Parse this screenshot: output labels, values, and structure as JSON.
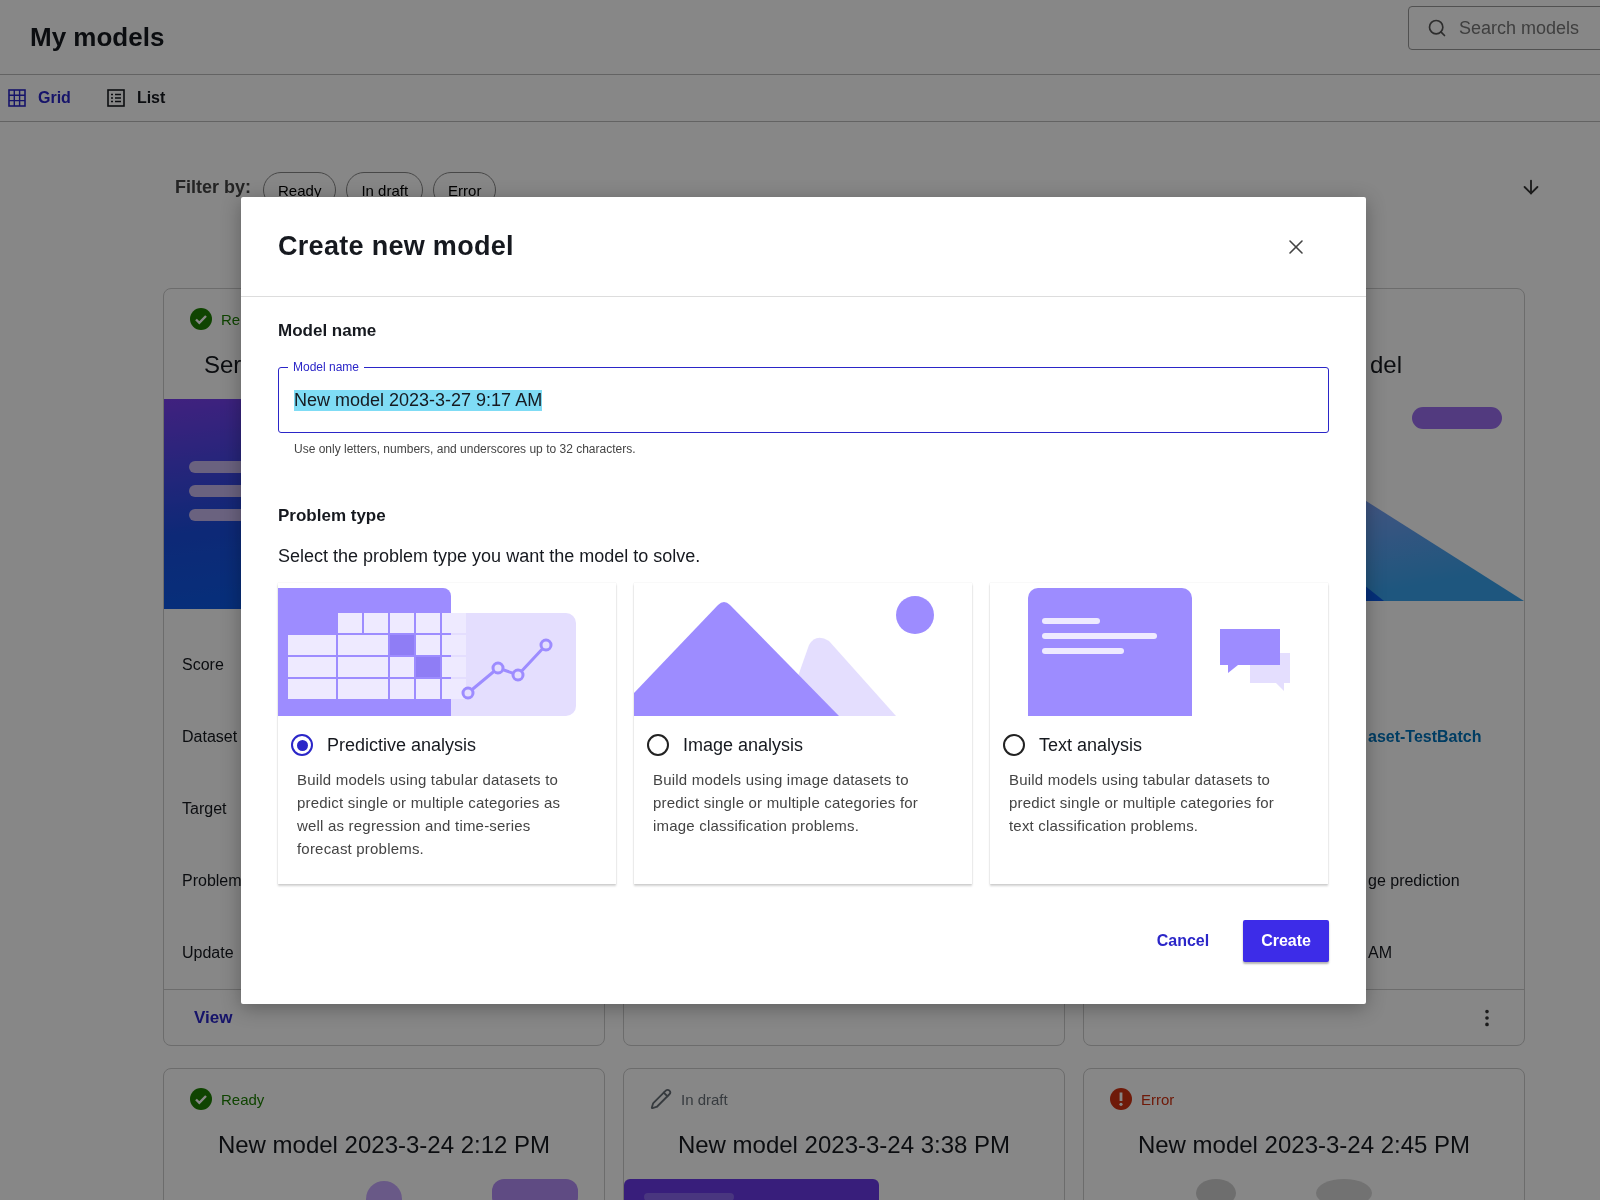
{
  "header": {
    "title": "My models",
    "search": {
      "placeholder": "Search models"
    }
  },
  "view_tabs": [
    {
      "label": "Grid",
      "selected": true
    },
    {
      "label": "List",
      "selected": false
    }
  ],
  "filter": {
    "label": "Filter by:",
    "chips": [
      {
        "label": "Ready",
        "selected": false
      },
      {
        "label": "In draft",
        "selected": false
      },
      {
        "label": "Error",
        "selected": false
      }
    ]
  },
  "top_cards": {
    "left": {
      "kind": "ready",
      "status_label": "Re",
      "title": "Ser",
      "fields": [
        "Score",
        "Dataset",
        "Target",
        "Problem",
        "Update"
      ],
      "action": "View"
    },
    "right": {
      "title": "del",
      "dataset": "aset-TestBatch",
      "problem": "ge prediction",
      "updated": "AM"
    }
  },
  "bottom_cards": [
    {
      "kind": "ready",
      "status_label": "Ready",
      "title": "New model 2023-3-24 2:12 PM"
    },
    {
      "kind": "draft",
      "status_label": "In draft",
      "title": "New model 2023-3-24 3:38 PM"
    },
    {
      "kind": "error",
      "status_label": "Error",
      "title": "New model 2023-3-24 2:45 PM"
    }
  ],
  "dialog": {
    "title": "Create new model",
    "model_name": {
      "heading": "Model name",
      "label": "Model name",
      "value": "New model 2023-3-27 9:17 AM",
      "hint": "Use only letters, numbers, and underscores up to 32 characters."
    },
    "problem_type": {
      "heading": "Problem type",
      "description": "Select the problem type you want the model to solve.",
      "options": [
        {
          "kind": "predictive",
          "label": "Predictive analysis",
          "description": "Build models using tabular datasets to predict single or multiple categories as well as regression and time-series forecast problems.",
          "selected": true
        },
        {
          "label": "Image analysis",
          "description": "Build models using image datasets to predict single or multiple categories for image classification problems.",
          "selected": false
        },
        {
          "kind": "text",
          "label": "Text analysis",
          "description": "Build models using tabular datasets to predict single or multiple categories for text classification problems.",
          "selected": false
        }
      ]
    },
    "buttons": [
      {
        "kind": "secondary",
        "label": "Cancel"
      },
      {
        "kind": "primary",
        "label": "Create"
      }
    ]
  }
}
